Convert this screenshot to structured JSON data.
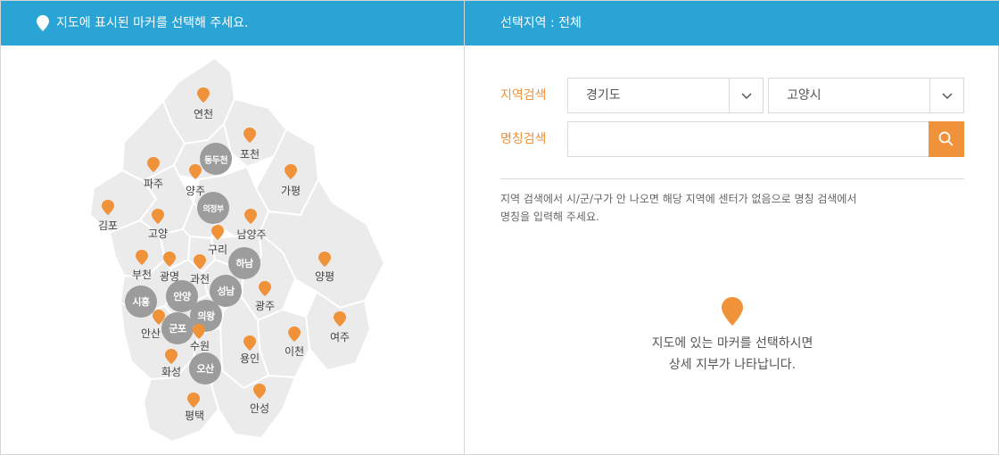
{
  "left_panel": {
    "header": "지도에 표시된 마커를 선택해 주세요.",
    "map": {
      "marker_color": "#f0923a",
      "circle_color": "#9c9c9c",
      "regions": [
        {
          "name": "연천",
          "kind": "marker"
        },
        {
          "name": "포천",
          "kind": "marker"
        },
        {
          "name": "동두천",
          "kind": "circle"
        },
        {
          "name": "파주",
          "kind": "marker"
        },
        {
          "name": "양주",
          "kind": "marker"
        },
        {
          "name": "가평",
          "kind": "marker"
        },
        {
          "name": "김포",
          "kind": "marker"
        },
        {
          "name": "의정부",
          "kind": "circle"
        },
        {
          "name": "고양",
          "kind": "marker"
        },
        {
          "name": "남양주",
          "kind": "marker"
        },
        {
          "name": "구리",
          "kind": "marker"
        },
        {
          "name": "하남",
          "kind": "circle"
        },
        {
          "name": "부천",
          "kind": "marker"
        },
        {
          "name": "광명",
          "kind": "marker"
        },
        {
          "name": "과천",
          "kind": "marker"
        },
        {
          "name": "양평",
          "kind": "marker"
        },
        {
          "name": "성남",
          "kind": "circle"
        },
        {
          "name": "안양",
          "kind": "circle"
        },
        {
          "name": "시흥",
          "kind": "circle"
        },
        {
          "name": "광주",
          "kind": "marker"
        },
        {
          "name": "의왕",
          "kind": "circle"
        },
        {
          "name": "안산",
          "kind": "marker"
        },
        {
          "name": "군포",
          "kind": "circle"
        },
        {
          "name": "여주",
          "kind": "marker"
        },
        {
          "name": "수원",
          "kind": "marker"
        },
        {
          "name": "이천",
          "kind": "marker"
        },
        {
          "name": "용인",
          "kind": "marker"
        },
        {
          "name": "화성",
          "kind": "marker"
        },
        {
          "name": "오산",
          "kind": "circle"
        },
        {
          "name": "평택",
          "kind": "marker"
        },
        {
          "name": "안성",
          "kind": "marker"
        }
      ]
    }
  },
  "right_panel": {
    "header": "선택지역 : 전체",
    "region_search": {
      "label": "지역검색",
      "province_value": "경기도",
      "city_value": "고양시"
    },
    "name_search": {
      "label": "명칭검색",
      "value": "",
      "placeholder": ""
    },
    "note_line1": "지역 검색에서 시/군/구가 안 나오면 해당 지역에 센터가 없음으로 명칭 검색에서",
    "note_line2": "명칭을 입력해 주세요.",
    "empty_line1": "지도에 있는 마커를 선택하시면",
    "empty_line2": "상세 지부가 나타납니다."
  },
  "colors": {
    "header_bg": "#2aa4d4",
    "accent": "#f0923a",
    "map_fill": "#ebebeb"
  }
}
